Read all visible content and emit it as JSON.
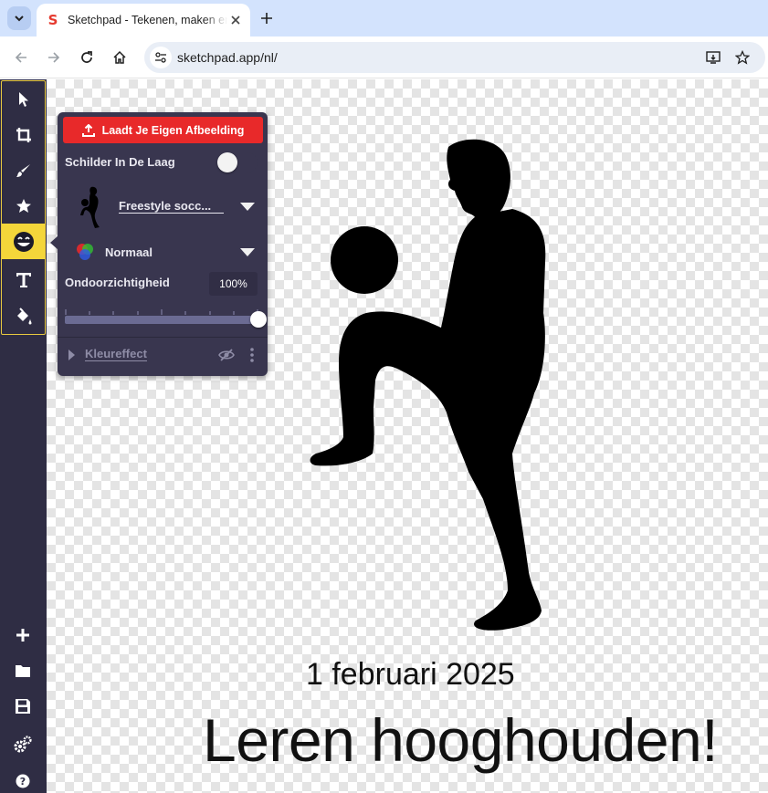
{
  "browser": {
    "tab_title": "Sketchpad - Tekenen, maken en delen!",
    "favicon_letter": "S",
    "url": "sketchpad.app/nl/"
  },
  "panel": {
    "upload_label": "Laadt Je Eigen Afbeelding",
    "paint_in_layer_label": "Schilder In De Laag",
    "paint_in_layer_on": false,
    "image_name": "Freestyle socc...",
    "blend_mode": "Normaal",
    "opacity_label": "Ondoorzichtigheid",
    "opacity_value": "100%",
    "opacity_fraction": 1.0,
    "effect_label": "Kleureffect"
  },
  "canvas": {
    "date_text": "1 februari 2025",
    "title_text": "Leren hooghouden!"
  },
  "colors": {
    "sidebar": "#2f2d44",
    "active_tool": "#f4d63a",
    "panel": "#39364f",
    "upload_button": "#e8292a"
  },
  "icons": {
    "tools": [
      "select-icon",
      "crop-icon",
      "brush-icon",
      "star-icon",
      "emoji-icon",
      "text-icon",
      "fill-icon"
    ],
    "bottom": [
      "add-icon",
      "folder-icon",
      "save-icon",
      "settings-icon",
      "help-icon"
    ]
  }
}
